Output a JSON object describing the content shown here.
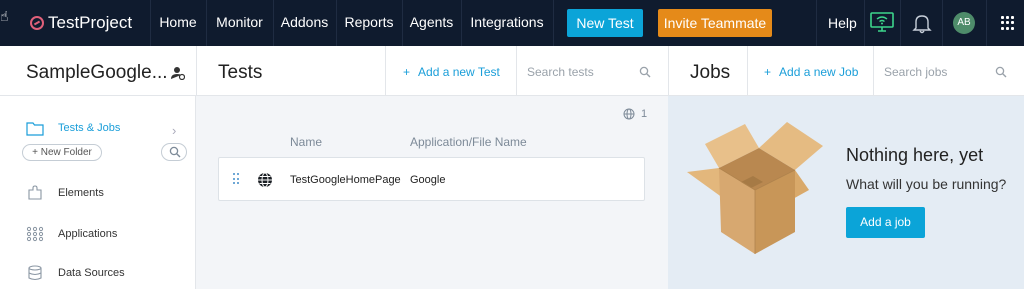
{
  "nav": {
    "brand": "TestProject",
    "items": [
      {
        "label": "Home"
      },
      {
        "label": "Monitor"
      },
      {
        "label": "Addons"
      },
      {
        "label": "Reports"
      },
      {
        "label": "Agents"
      },
      {
        "label": "Integrations"
      }
    ],
    "new_test_label": "New Test",
    "invite_label": "Invite Teammate",
    "help_label": "Help",
    "avatar_initials": "AB"
  },
  "project": {
    "title": "SampleGoogle..."
  },
  "tests": {
    "title": "Tests",
    "add_label": "Add a new Test",
    "search_placeholder": "Search tests",
    "count": "1",
    "columns": [
      "Name",
      "Application/File Name"
    ],
    "rows": [
      {
        "name": "TestGoogleHomePage",
        "app": "Google"
      }
    ]
  },
  "jobs": {
    "title": "Jobs",
    "add_label": "Add a new Job",
    "search_placeholder": "Search jobs",
    "empty_title": "Nothing here, yet",
    "empty_subtitle": "What will you be running?",
    "add_job_button": "Add a job"
  },
  "sidebar": {
    "items": [
      {
        "label": "Tests & Jobs",
        "icon": "folder-icon"
      },
      {
        "label": "Elements",
        "icon": "puzzle-icon"
      },
      {
        "label": "Applications",
        "icon": "grid-icon"
      },
      {
        "label": "Data Sources",
        "icon": "database-icon"
      }
    ],
    "new_folder_label": "+ New Folder"
  },
  "colors": {
    "nav_bg": "#0f1b2e",
    "accent": "#0ba4d8",
    "invite": "#e58a19",
    "link": "#1a9ed9"
  }
}
